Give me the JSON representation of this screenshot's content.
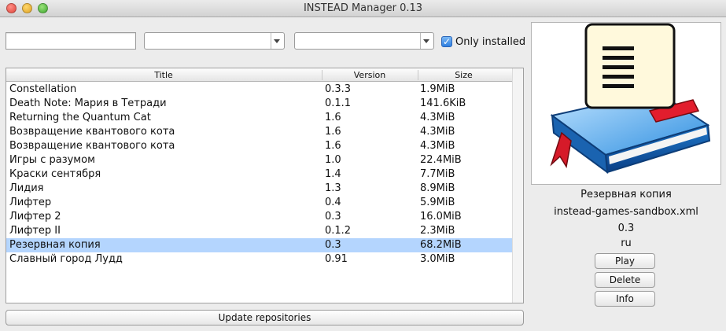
{
  "window": {
    "title": "INSTEAD Manager 0.13"
  },
  "filters": {
    "search_value": "",
    "combo1_value": "",
    "combo2_value": "",
    "only_installed_label": "Only installed",
    "only_installed_checked": true
  },
  "table": {
    "headers": {
      "title": "Title",
      "version": "Version",
      "size": "Size"
    },
    "rows": [
      {
        "title": "Constellation",
        "version": "0.3.3",
        "size": "1.9MiB"
      },
      {
        "title": "Death Note: Мария в Тетради",
        "version": "0.1.1",
        "size": "141.6KiB"
      },
      {
        "title": "Returning the Quantum Cat",
        "version": "1.6",
        "size": "4.3MiB"
      },
      {
        "title": "Возвращение квантового кота",
        "version": "1.6",
        "size": "4.3MiB"
      },
      {
        "title": "Возвращение квантового кота",
        "version": "1.6",
        "size": "4.3MiB"
      },
      {
        "title": "Игры с разумом",
        "version": "1.0",
        "size": "22.4MiB"
      },
      {
        "title": "Краски сентября",
        "version": "1.4",
        "size": "7.7MiB"
      },
      {
        "title": "Лидия",
        "version": "1.3",
        "size": "8.9MiB"
      },
      {
        "title": "Лифтер",
        "version": "0.4",
        "size": "5.9MiB"
      },
      {
        "title": "Лифтер 2",
        "version": "0.3",
        "size": "16.0MiB"
      },
      {
        "title": "Лифтер II",
        "version": "0.1.2",
        "size": "2.3MiB"
      },
      {
        "title": "Резервная копия",
        "version": "0.3",
        "size": "68.2MiB"
      },
      {
        "title": "Славный город Лудд",
        "version": "0.91",
        "size": "3.0MiB"
      }
    ],
    "selected_index": 11
  },
  "update_button_label": "Update repositories",
  "details": {
    "icon": "book-with-document-icon",
    "name": "Резервная копия",
    "repository": "instead-games-sandbox.xml",
    "version": "0.3",
    "language": "ru"
  },
  "actions": {
    "play": "Play",
    "delete": "Delete",
    "info": "Info"
  },
  "colors": {
    "selection": "#b4d5fe",
    "checkbox_accent": "#2f7fe0"
  }
}
